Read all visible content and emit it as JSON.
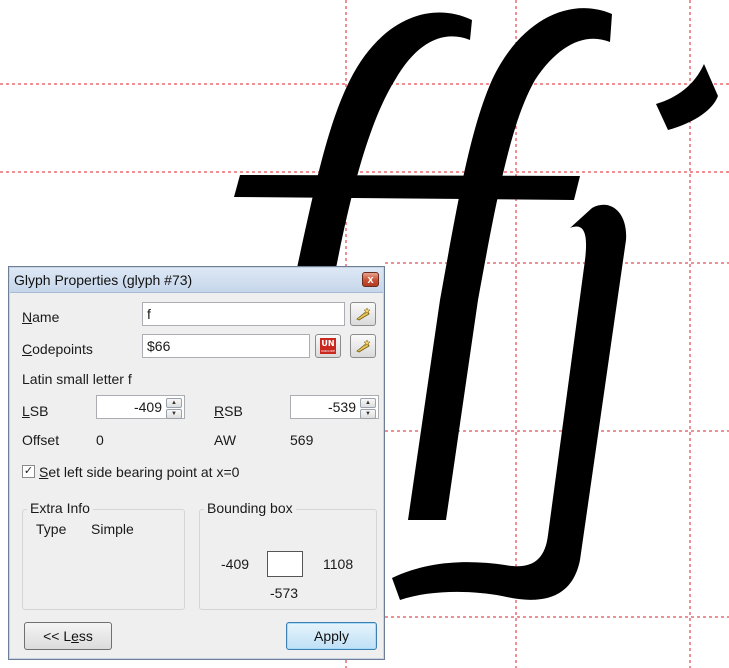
{
  "dialog": {
    "title": "Glyph Properties (glyph #73)",
    "close_symbol": "x",
    "name": {
      "label": "Name",
      "mnemonic": "N",
      "rest": "ame",
      "value": "f"
    },
    "codepoints": {
      "label": "Codepoints",
      "mnemonic": "C",
      "rest": "odepoints",
      "value": "$66"
    },
    "unicode_logo": {
      "main": "UN",
      "small": "UNICODE"
    },
    "char_description": "Latin small letter f",
    "lsb": {
      "label": "LSB",
      "mnemonic": "L",
      "rest": "SB",
      "value": "-409"
    },
    "rsb": {
      "label": "RSB",
      "mnemonic": "R",
      "rest": "SB",
      "value": "-539"
    },
    "offset": {
      "label": "Offset",
      "value": "0"
    },
    "aw": {
      "label": "AW",
      "value": "569"
    },
    "checkbox": {
      "checked": true,
      "mark": "✓",
      "mnemonic": "S",
      "rest": "et left side bearing point at x=0"
    },
    "extra_info": {
      "title": "Extra Info",
      "type_label": "Type",
      "type_value": "Simple"
    },
    "bounding_box": {
      "title": "Bounding box",
      "left": "-409",
      "right": "1108",
      "bottom": "-573"
    },
    "less_button": {
      "prefix": "<< L",
      "mnemonic": "e",
      "rest": "ss"
    },
    "apply_button": "Apply"
  },
  "icons": {
    "pick": "wand-icon",
    "close": "close-icon",
    "unicode": "unicode-logo-icon"
  },
  "colors": {
    "guide_line": "#e0212a",
    "glyph": "#000000",
    "apply_accent": "#3c7fb1"
  }
}
